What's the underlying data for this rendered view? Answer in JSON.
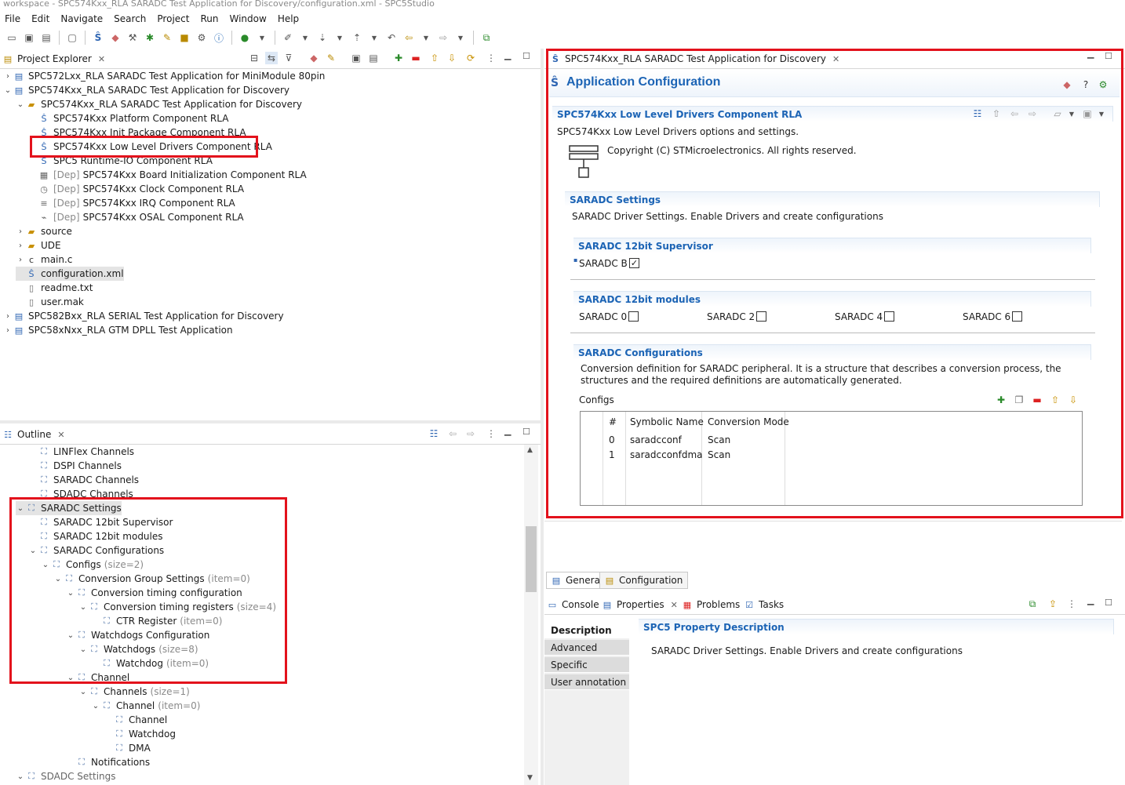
{
  "window": {
    "title": "workspace - SPC574Kxx_RLA SARADC Test Application for Discovery/configuration.xml - SPC5Studio"
  },
  "menu": [
    "File",
    "Edit",
    "Navigate",
    "Search",
    "Project",
    "Run",
    "Window",
    "Help"
  ],
  "project_explorer": {
    "tab_label": "Project Explorer",
    "rows": [
      {
        "twisty": "›",
        "text": "SPC572Lxx_RLA SARADC Test Application for MiniModule 80pin",
        "icon": "project-icon"
      },
      {
        "twisty": "⌄",
        "text": "SPC574Kxx_RLA SARADC Test Application for Discovery",
        "icon": "project-icon"
      },
      {
        "twisty": "⌄",
        "text": "SPC574Kxx_RLA SARADC Test Application for Discovery",
        "icon": "folder-icon"
      },
      {
        "twisty": "",
        "text": "SPC574Kxx Platform Component RLA",
        "icon": "component-icon"
      },
      {
        "twisty": "",
        "text": "SPC574Kxx Init Package Component RLA",
        "icon": "component-icon"
      },
      {
        "twisty": "",
        "text": "SPC574Kxx Low Level Drivers Component RLA",
        "icon": "component-icon"
      },
      {
        "twisty": "",
        "text": "SPC5 Runtime-IO Component RLA",
        "icon": "component-icon"
      },
      {
        "twisty": "",
        "text": "SPC574Kxx Board Initialization Component RLA",
        "dep": "[Dep]",
        "icon": "board-icon"
      },
      {
        "twisty": "",
        "text": "SPC574Kxx Clock Component RLA",
        "dep": "[Dep]",
        "icon": "clock-icon"
      },
      {
        "twisty": "",
        "text": "SPC574Kxx IRQ Component RLA",
        "dep": "[Dep]",
        "icon": "irq-icon"
      },
      {
        "twisty": "",
        "text": "SPC574Kxx OSAL Component RLA",
        "dep": "[Dep]",
        "icon": "osal-icon"
      },
      {
        "twisty": "›",
        "text": "source",
        "icon": "folder-icon"
      },
      {
        "twisty": "›",
        "text": "UDE",
        "icon": "folder-icon"
      },
      {
        "twisty": "›",
        "text": "main.c",
        "icon": "c-file-icon"
      },
      {
        "twisty": "",
        "text": "configuration.xml",
        "icon": "config-file-icon"
      },
      {
        "twisty": "",
        "text": "readme.txt",
        "icon": "text-file-icon"
      },
      {
        "twisty": "",
        "text": "user.mak",
        "icon": "text-file-icon"
      },
      {
        "twisty": "›",
        "text": "SPC582Bxx_RLA SERIAL Test Application for Discovery",
        "icon": "project-icon"
      },
      {
        "twisty": "›",
        "text": "SPC58xNxx_RLA GTM DPLL Test Application",
        "icon": "project-icon"
      }
    ]
  },
  "outline": {
    "tab_label": "Outline",
    "rows": [
      {
        "twisty": "",
        "text": "LINFlex Channels",
        "suffix": ""
      },
      {
        "twisty": "",
        "text": "DSPI Channels",
        "suffix": ""
      },
      {
        "twisty": "",
        "text": "SARADC Channels",
        "suffix": ""
      },
      {
        "twisty": "",
        "text": "SDADC Channels",
        "suffix": ""
      },
      {
        "twisty": "⌄",
        "text": "SARADC Settings",
        "suffix": ""
      },
      {
        "twisty": "",
        "text": "SARADC 12bit Supervisor",
        "suffix": ""
      },
      {
        "twisty": "",
        "text": "SARADC 12bit modules",
        "suffix": ""
      },
      {
        "twisty": "⌄",
        "text": "SARADC Configurations",
        "suffix": ""
      },
      {
        "twisty": "⌄",
        "text": "Configs",
        "suffix": "(size=2)"
      },
      {
        "twisty": "⌄",
        "text": "Conversion Group Settings",
        "suffix": "(item=0)"
      },
      {
        "twisty": "⌄",
        "text": "Conversion timing configuration",
        "suffix": ""
      },
      {
        "twisty": "⌄",
        "text": "Conversion timing registers",
        "suffix": "(size=4)"
      },
      {
        "twisty": "",
        "text": "CTR Register",
        "suffix": "(item=0)"
      },
      {
        "twisty": "⌄",
        "text": "Watchdogs Configuration",
        "suffix": ""
      },
      {
        "twisty": "⌄",
        "text": "Watchdogs",
        "suffix": "(size=8)"
      },
      {
        "twisty": "",
        "text": "Watchdog",
        "suffix": "(item=0)"
      },
      {
        "twisty": "⌄",
        "text": "Channel",
        "suffix": ""
      },
      {
        "twisty": "⌄",
        "text": "Channels",
        "suffix": "(size=1)"
      },
      {
        "twisty": "⌄",
        "text": "Channel",
        "suffix": "(item=0)"
      },
      {
        "twisty": "",
        "text": "Channel",
        "suffix": ""
      },
      {
        "twisty": "",
        "text": "Watchdog",
        "suffix": ""
      },
      {
        "twisty": "",
        "text": "DMA",
        "suffix": ""
      },
      {
        "twisty": "",
        "text": "Notifications",
        "suffix": ""
      },
      {
        "twisty": "⌄",
        "text": "SDADC Settings",
        "suffix": ""
      }
    ]
  },
  "editor": {
    "tab_label": "SPC574Kxx_RLA SARADC Test Application for Discovery",
    "heading": "Application Configuration",
    "component": {
      "title": "SPC574Kxx Low Level Drivers Component RLA",
      "description": "SPC574Kxx Low Level Drivers options and settings.",
      "copyright": "Copyright (C) STMicroelectronics. All rights reserved."
    },
    "saradc_settings": {
      "title": "SARADC Settings",
      "description": "SARADC Driver Settings. Enable Drivers and create configurations",
      "supervisor": {
        "title": "SARADC 12bit Supervisor",
        "label": "SARADC B",
        "checked": true,
        "check_mark": "✓"
      },
      "modules": {
        "title": "SARADC 12bit modules",
        "items": [
          {
            "label": "SARADC 0",
            "checked": false
          },
          {
            "label": "SARADC 2",
            "checked": false
          },
          {
            "label": "SARADC 4",
            "checked": false
          },
          {
            "label": "SARADC 6",
            "checked": false
          }
        ]
      },
      "configurations": {
        "title": "SARADC Configurations",
        "description": "Conversion definition for SARADC peripheral. It is a structure that describes a conversion process, the structures and the required definitions are automatically generated.",
        "configs_label": "Configs",
        "columns": [
          "#",
          "Symbolic Name",
          "Conversion Mode"
        ],
        "rows": [
          [
            "0",
            "saradcconf",
            "Scan"
          ],
          [
            "1",
            "saradcconfdma",
            "Scan"
          ]
        ]
      }
    },
    "bottom_tabs": [
      "General",
      "Configuration"
    ]
  },
  "console_area": {
    "tabs": [
      "Console",
      "Properties",
      "Problems",
      "Tasks"
    ],
    "property_title": "SPC5 Property Description",
    "side_tabs": [
      "Description",
      "Advanced",
      "Specific",
      "User annotation"
    ],
    "description_text": "SARADC Driver Settings. Enable Drivers and create configurations"
  },
  "colors": {
    "accent": "#1c64b5",
    "highlight_border": "#e3121c"
  }
}
